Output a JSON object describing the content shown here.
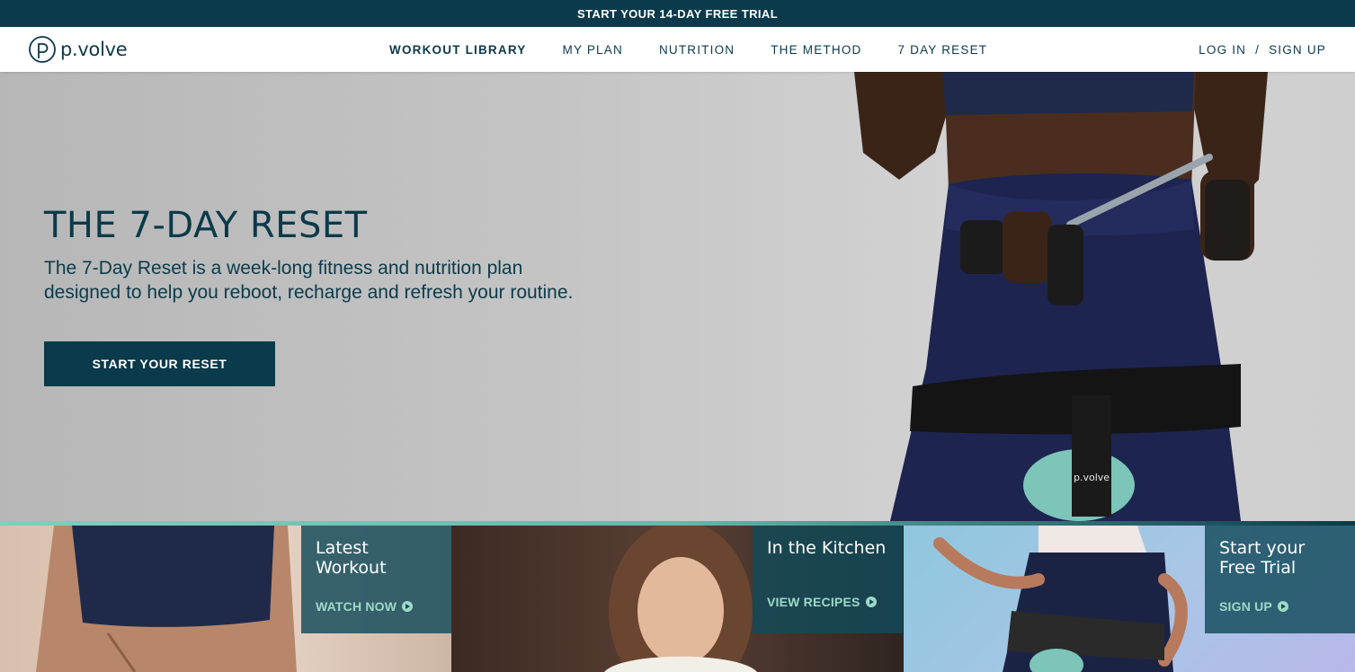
{
  "promo": {
    "text": "START YOUR 14-DAY FREE TRIAL"
  },
  "brand": {
    "name": "p.volve",
    "color": "#0b3a4a",
    "accent": "#7fcfbd"
  },
  "nav": {
    "links": [
      {
        "label": "WORKOUT LIBRARY"
      },
      {
        "label": "MY PLAN"
      },
      {
        "label": "NUTRITION"
      },
      {
        "label": "THE METHOD"
      },
      {
        "label": "7 DAY RESET"
      }
    ],
    "login": "LOG IN",
    "separator": "/",
    "signup": "SIGN UP"
  },
  "hero": {
    "title": "THE 7-DAY RESET",
    "description": "The 7-Day Reset is a week-long fitness and nutrition plan designed to help you reboot, recharge and refresh your routine.",
    "button": "START YOUR RESET",
    "product_mark": "p.volve"
  },
  "cards": [
    {
      "title": "Latest Workout",
      "cta": "WATCH NOW",
      "icon": "play-circle-icon"
    },
    {
      "title": "In the Kitchen",
      "cta": "VIEW RECIPES",
      "icon": "play-circle-icon"
    },
    {
      "title": "Start your Free Trial",
      "cta": "SIGN UP",
      "icon": "play-circle-icon"
    }
  ]
}
